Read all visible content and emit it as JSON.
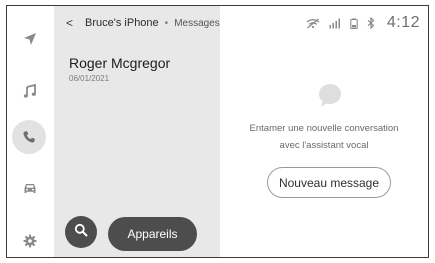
{
  "header": {
    "back_label": "<",
    "device_name": "Bruce's iPhone",
    "separator": "•",
    "section": "Messages"
  },
  "status_bar": {
    "time": "4:12",
    "icons": [
      "no-wifi-icon",
      "signal-icon",
      "battery-icon",
      "bluetooth-icon"
    ]
  },
  "sidebar": {
    "items": [
      {
        "icon": "navigation-arrow-icon",
        "active": false
      },
      {
        "icon": "music-note-icon",
        "active": false
      },
      {
        "icon": "phone-icon",
        "active": true
      },
      {
        "icon": "car-icon",
        "active": false
      },
      {
        "icon": "gear-icon",
        "active": false
      }
    ]
  },
  "messages": [
    {
      "name": "Roger Mcgregor",
      "date": "06/01/2021"
    }
  ],
  "panel_buttons": {
    "search_icon": "search-icon",
    "devices_label": "Appareils"
  },
  "empty_state": {
    "icon": "chat-bubble-icon",
    "line1": "Entamer une nouvelle conversation",
    "line2": "avec l'assistant vocal",
    "new_message_label": "Nouveau message"
  },
  "colors": {
    "panel_bg": "#e8e8e8",
    "button_dark": "#4d4d4d",
    "active_rail": "#e2e2e2",
    "icon_gray": "#8a8a8a"
  }
}
